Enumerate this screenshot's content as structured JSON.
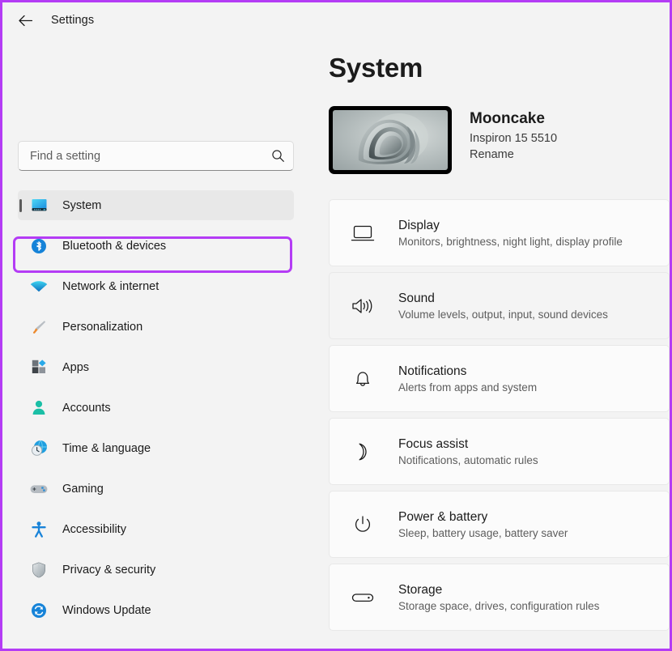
{
  "window": {
    "title": "Settings",
    "back_icon": "back-arrow-icon"
  },
  "accent_colors": {
    "annotation_purple": "#b43cf5",
    "page_background": "#f3f3f3",
    "card_background": "#fbfbfb",
    "selected_nav_background": "#e8e8e8",
    "text_primary": "#1b1b1b",
    "text_secondary": "#5d5d5d"
  },
  "search": {
    "placeholder": "Find a setting",
    "value": "",
    "icon": "search-icon"
  },
  "sidebar": {
    "items": [
      {
        "label": "System",
        "icon": "monitor-icon",
        "selected": true
      },
      {
        "label": "Bluetooth & devices",
        "icon": "bluetooth-icon",
        "selected": false
      },
      {
        "label": "Network & internet",
        "icon": "wifi-icon",
        "selected": false
      },
      {
        "label": "Personalization",
        "icon": "paintbrush-icon",
        "selected": false
      },
      {
        "label": "Apps",
        "icon": "apps-icon",
        "selected": false
      },
      {
        "label": "Accounts",
        "icon": "person-icon",
        "selected": false
      },
      {
        "label": "Time & language",
        "icon": "clock-globe-icon",
        "selected": false
      },
      {
        "label": "Gaming",
        "icon": "gamepad-icon",
        "selected": false
      },
      {
        "label": "Accessibility",
        "icon": "accessibility-icon",
        "selected": false
      },
      {
        "label": "Privacy & security",
        "icon": "shield-icon",
        "selected": false
      },
      {
        "label": "Windows Update",
        "icon": "update-sync-icon",
        "selected": false
      }
    ]
  },
  "main": {
    "page_title": "System",
    "device": {
      "name": "Mooncake",
      "model": "Inspiron 15 5510",
      "rename_label": "Rename",
      "thumbnail": "windows-bloom-wallpaper-thumbnail"
    },
    "cards": [
      {
        "title": "Display",
        "subtitle": "Monitors, brightness, night light, display profile",
        "icon": "display-monitor-icon",
        "hover": false
      },
      {
        "title": "Sound",
        "subtitle": "Volume levels, output, input, sound devices",
        "icon": "speaker-icon",
        "hover": true
      },
      {
        "title": "Notifications",
        "subtitle": "Alerts from apps and system",
        "icon": "bell-icon",
        "hover": false
      },
      {
        "title": "Focus assist",
        "subtitle": "Notifications, automatic rules",
        "icon": "moon-icon",
        "hover": false
      },
      {
        "title": "Power & battery",
        "subtitle": "Sleep, battery usage, battery saver",
        "icon": "power-icon",
        "hover": false
      },
      {
        "title": "Storage",
        "subtitle": "Storage space, drives, configuration rules",
        "icon": "storage-drive-icon",
        "hover": false
      }
    ]
  }
}
